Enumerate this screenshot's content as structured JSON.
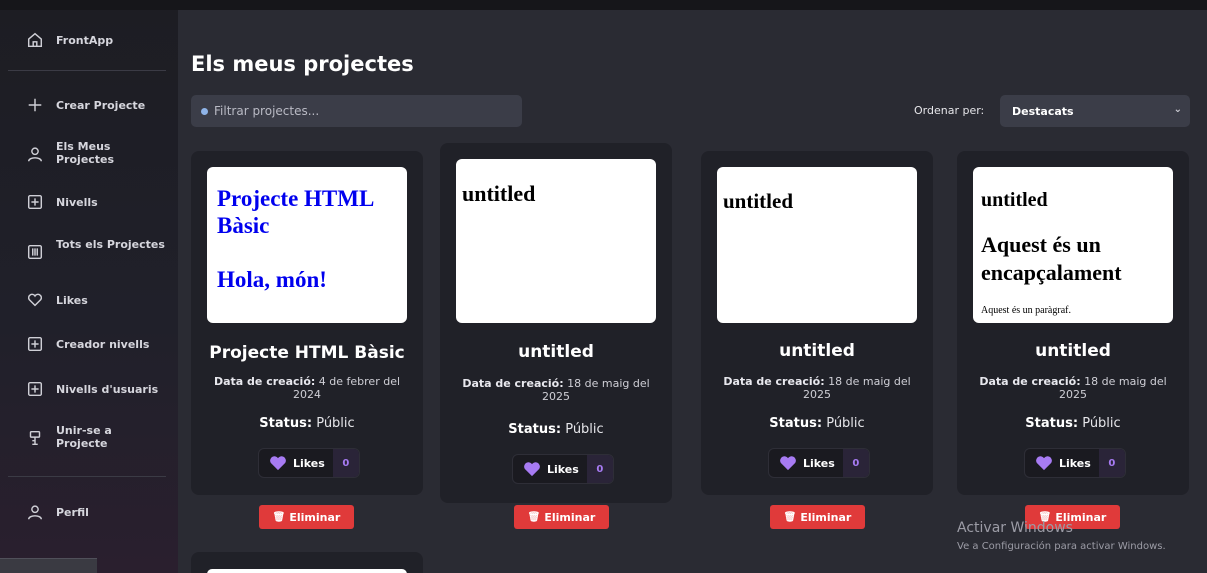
{
  "sidebar": {
    "brand": "FrontApp",
    "items": [
      {
        "label": "Crear Projecte",
        "icon": "plus-icon"
      },
      {
        "label": "Els Meus Projectes",
        "icon": "user-icon"
      },
      {
        "label": "Nivells",
        "icon": "plus-square-icon"
      },
      {
        "label": "Tots els Projectes",
        "icon": "grid-icon"
      },
      {
        "label": "Likes",
        "icon": "heart-outline-icon"
      },
      {
        "label": "Creador nivells",
        "icon": "plus-square-icon"
      },
      {
        "label": "Nivells d'usuaris",
        "icon": "plus-square-icon"
      },
      {
        "label": "Unir-se a Projecte",
        "icon": "join-icon"
      }
    ],
    "profile": "Perfil"
  },
  "main": {
    "title": "Els meus projectes",
    "filter_placeholder": "Filtrar projectes...",
    "sort_label": "Ordenar per:",
    "sort_value": "Destacats"
  },
  "labels": {
    "date_prefix": "Data de creació:",
    "status_prefix": "Status:",
    "likes": "Likes",
    "delete": "Eliminar"
  },
  "cards": [
    {
      "preview": {
        "h1": "Projecte HTML Bàsic",
        "h2": "Hola, món!"
      },
      "title": "Projecte HTML Bàsic",
      "date": "4 de febrer del 2024",
      "status": "Públic",
      "likes": "0"
    },
    {
      "preview": {
        "h1": "untitled"
      },
      "title": "untitled",
      "date": "18 de maig del 2025",
      "status": "Públic",
      "likes": "0"
    },
    {
      "preview": {
        "h1": "untitled"
      },
      "title": "untitled",
      "date": "18 de maig del 2025",
      "status": "Públic",
      "likes": "0"
    },
    {
      "preview": {
        "h1": "untitled",
        "h2": "Aquest és un encapçalament",
        "p": "Aquest és un paràgraf."
      },
      "title": "untitled",
      "date": "18 de maig del 2025",
      "status": "Públic",
      "likes": "0"
    }
  ],
  "watermark": {
    "line1": "Activar Windows",
    "line2": "Ve a Configuración para activar Windows."
  },
  "colors": {
    "accent_purple": "#a77bf3",
    "delete_red": "#e03a3a",
    "preview_blue": "#0000ee"
  }
}
